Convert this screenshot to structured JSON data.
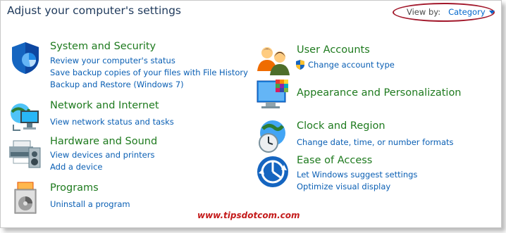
{
  "header": {
    "title": "Adjust your computer's settings",
    "view_by_label": "View by:",
    "view_by_value": "Category"
  },
  "categories": [
    {
      "title": "System and Security",
      "icon": "shield-icon",
      "links": [
        "Review your computer's status",
        "Save backup copies of your files with File History",
        "Backup and Restore (Windows 7)"
      ]
    },
    {
      "title": "Network and Internet",
      "icon": "network-globe-icon",
      "links": [
        "View network status and tasks"
      ]
    },
    {
      "title": "Hardware and Sound",
      "icon": "printer-icon",
      "links": [
        "View devices and printers",
        "Add a device"
      ]
    },
    {
      "title": "Programs",
      "icon": "programs-disc-icon",
      "links": [
        "Uninstall a program"
      ]
    },
    {
      "title": "User Accounts",
      "icon": "users-icon",
      "links": [
        "Change account type"
      ]
    },
    {
      "title": "Appearance and Personalization",
      "icon": "monitor-palette-icon",
      "links": []
    },
    {
      "title": "Clock and Region",
      "icon": "clock-globe-icon",
      "links": [
        "Change date, time, or number formats"
      ]
    },
    {
      "title": "Ease of Access",
      "icon": "ease-of-access-icon",
      "links": [
        "Let Windows suggest settings",
        "Optimize visual display"
      ]
    }
  ],
  "watermark": "www.tipsdotcom.com",
  "colors": {
    "title": "#1e395b",
    "category_title": "#1e7a1e",
    "link": "#0a5fb4",
    "highlight_oval": "#a2182b",
    "watermark": "#c41b1b"
  }
}
